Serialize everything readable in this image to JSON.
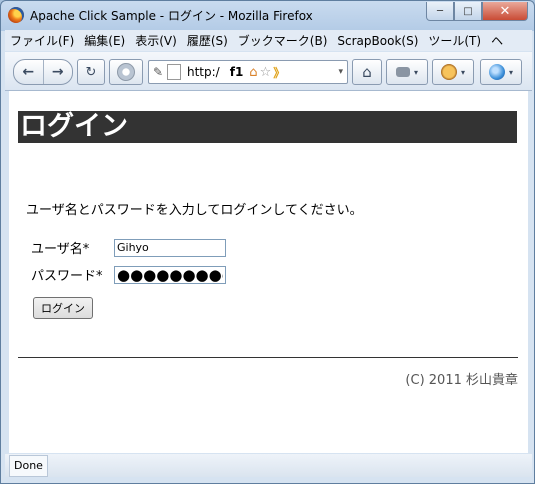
{
  "window": {
    "title": "Apache Click Sample - ログイン - Mozilla Firefox",
    "controls": {
      "minimize": "─",
      "maximize": "□",
      "close": "✕"
    }
  },
  "menubar": {
    "items": [
      "ファイル(F)",
      "編集(E)",
      "表示(V)",
      "履歴(S)",
      "ブックマーク(B)",
      "ScrapBook(S)",
      "ツール(T)",
      "ヘ"
    ]
  },
  "navbar": {
    "back_icon": "←",
    "forward_icon": "→",
    "reload_icon": "↻",
    "url_text": "http:/",
    "url_suffix": "f1",
    "home_icon": "⌂",
    "bookmark_star": "☆",
    "go_arrow": "》",
    "dropdown": "▾"
  },
  "page": {
    "heading": "ログイン",
    "instruction": "ユーザ名とパスワードを入力してログインしてください。",
    "username_label": "ユーザ名*",
    "username_value": "Gihyo",
    "password_label": "パスワード*",
    "password_value": "●●●●●●●●●",
    "login_button": "ログイン",
    "footer": "(C) 2011 杉山貴章"
  },
  "status": {
    "text": "Done"
  }
}
